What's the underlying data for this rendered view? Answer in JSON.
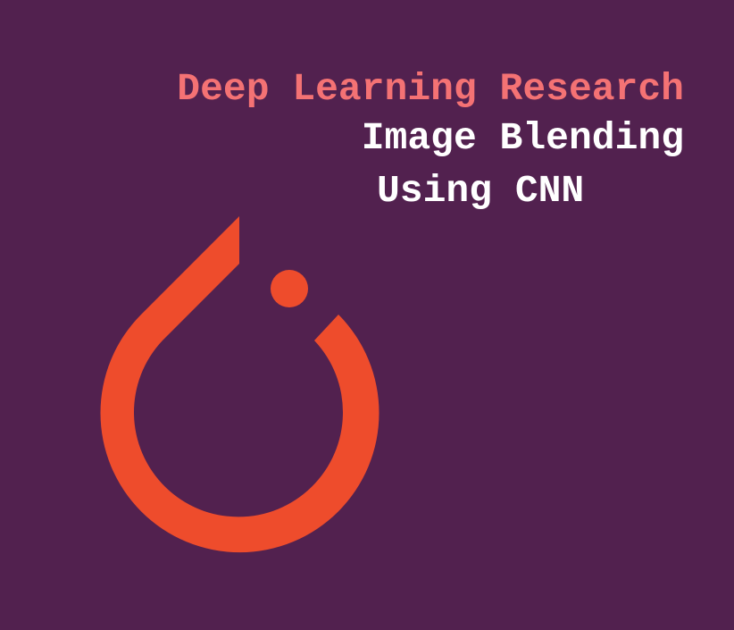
{
  "banner": {
    "background_color": "#52214F",
    "heading": "Deep Learning Research",
    "heading_color": "#F47274",
    "title_line_1": "Image Blending",
    "title_line_2": "Using CNN",
    "title_color": "#FFFFFF"
  },
  "logo": {
    "icon": "pytorch-flame-icon",
    "color": "#EE4C2C"
  }
}
